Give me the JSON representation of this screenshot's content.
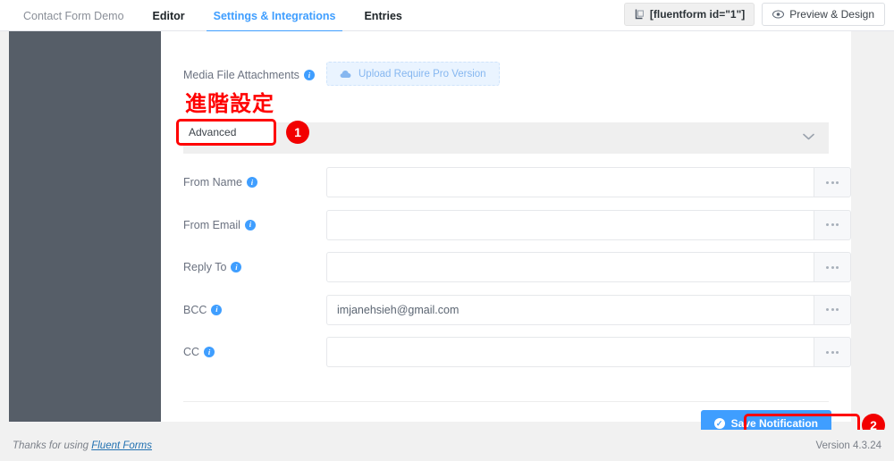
{
  "topbar": {
    "tabs": [
      {
        "label": "Contact Form Demo",
        "state": "muted"
      },
      {
        "label": "Editor",
        "state": "bold"
      },
      {
        "label": "Settings & Integrations",
        "state": "active"
      },
      {
        "label": "Entries",
        "state": "bold"
      }
    ],
    "shortcode_label": "[fluentform id=\"1\"]",
    "shortcode_icon": "shortcode-bracket-icon",
    "preview_label": "Preview & Design",
    "preview_icon": "eye-icon"
  },
  "main": {
    "media_attachments_label": "Media File Attachments",
    "media_info_icon": "info-icon",
    "upload_button_label": "Upload Require Pro Version",
    "upload_icon": "cloud-upload-icon",
    "section_heading_cn": "進階設定",
    "advanced_label": "Advanced",
    "advanced_chevron_icon": "chevron-down-icon",
    "fields": [
      {
        "label": "From Name",
        "value": "",
        "info_icon": "info-icon",
        "more_icon": "ellipsis-icon"
      },
      {
        "label": "From Email",
        "value": "",
        "info_icon": "info-icon",
        "more_icon": "ellipsis-icon"
      },
      {
        "label": "Reply To",
        "value": "",
        "info_icon": "info-icon",
        "more_icon": "ellipsis-icon"
      },
      {
        "label": "BCC",
        "value": "imjanehsieh@gmail.com",
        "info_icon": "info-icon",
        "more_icon": "ellipsis-icon"
      },
      {
        "label": "CC",
        "value": "",
        "info_icon": "info-icon",
        "more_icon": "ellipsis-icon"
      }
    ],
    "save_button_label": "Save Notification",
    "save_button_icon": "check-circle-icon"
  },
  "annotations": {
    "step_one": "1",
    "step_two": "2",
    "highlight_color": "#ff0000"
  },
  "footer": {
    "thanks_prefix": "Thanks for using ",
    "thanks_link": "Fluent Forms",
    "version": "Version 4.3.24"
  },
  "colors": {
    "accent": "#3f9eff",
    "sidebar": "#565e68",
    "highlight": "#ff0000",
    "page_bg": "#f1f1f1"
  }
}
